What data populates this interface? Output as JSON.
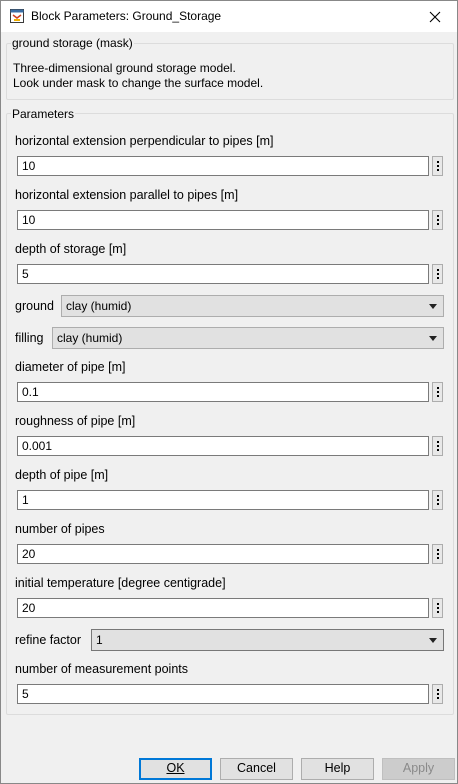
{
  "window": {
    "title": "Block Parameters: Ground_Storage"
  },
  "mask": {
    "group_title": "ground storage (mask)",
    "description_line1": "Three-dimensional ground storage model.",
    "description_line2": "Look under mask to change the surface model."
  },
  "parameters": {
    "group_title": "Parameters",
    "horizontal_perp": {
      "label": "horizontal extension perpendicular to pipes [m]",
      "value": "10"
    },
    "horizontal_par": {
      "label": "horizontal extension parallel to pipes [m]",
      "value": "10"
    },
    "depth_storage": {
      "label": "depth of storage [m]",
      "value": "5"
    },
    "ground": {
      "label": "ground",
      "value": "clay (humid)"
    },
    "filling": {
      "label": "filling",
      "value": "clay (humid)"
    },
    "diameter_pipe": {
      "label": "diameter of pipe [m]",
      "value": "0.1"
    },
    "roughness_pipe": {
      "label": "roughness of pipe [m]",
      "value": "0.001"
    },
    "depth_pipe": {
      "label": "depth of pipe [m]",
      "value": "1"
    },
    "number_pipes": {
      "label": "number of pipes",
      "value": "20"
    },
    "initial_temp": {
      "label": "initial temperature [degree centigrade]",
      "value": "20"
    },
    "refine_factor": {
      "label": "refine factor",
      "value": "1"
    },
    "measurement_points": {
      "label": "number of measurement points",
      "value": "5"
    }
  },
  "buttons": {
    "ok": "OK",
    "cancel": "Cancel",
    "help": "Help",
    "apply": "Apply"
  },
  "icons": {
    "app": "block-params-icon",
    "close": "close-icon",
    "more": "more-options-icon",
    "dropdown": "chevron-down-icon"
  }
}
